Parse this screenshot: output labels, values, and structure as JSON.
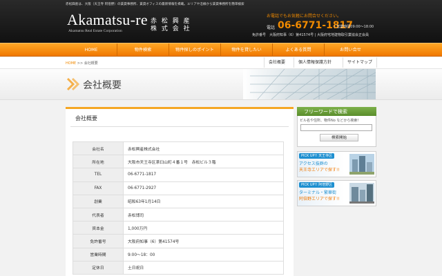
{
  "header": {
    "tagline": "赤松興産は、大阪（天王寺 阿倍野）の賃貸事務所、賃貸オフィスの最新情報を掲載。エリアや沿線から賃貸事務所を簡単検索",
    "logo": "Akamatsu-re",
    "logo_sub": "Akamatsu Real Estate Corporation",
    "company_jp_1": "赤 松 興 産",
    "company_jp_2": "株 式 会 社",
    "phone_cta": "お電話でもお気軽にお問合せください。",
    "phone_label": "電話",
    "phone_number": "06-6771-1817",
    "hours": "| 営業時間09:00～18:00",
    "license": "免許番号　大阪府知事（6）第41574号 | 大阪府宅地建物取引業協会正会員"
  },
  "nav": {
    "items": [
      {
        "label": "HOME"
      },
      {
        "label": "物件検索"
      },
      {
        "label": "物件探しのポイント"
      },
      {
        "label": "物件を貸したい"
      },
      {
        "label": "よくある質問"
      },
      {
        "label": "お問い合せ"
      }
    ]
  },
  "breadcrumb": {
    "home": "HOME",
    "sep": " >> ",
    "current": "会社概要"
  },
  "util_links": [
    {
      "label": "会社概要"
    },
    {
      "label": "個人情報保護方針"
    },
    {
      "label": "サイトマップ"
    }
  ],
  "hero": {
    "title": "会社概要"
  },
  "main": {
    "title": "会社概要",
    "rows": [
      {
        "k": "会社名",
        "v": "赤松興産株式会社"
      },
      {
        "k": "所在地",
        "v": "大阪市天王寺区茶臼山町４番１号　赤松ビル３階"
      },
      {
        "k": "TEL",
        "v": "06-6771-1817"
      },
      {
        "k": "FAX",
        "v": "06-6771-2927"
      },
      {
        "k": "創業",
        "v": "昭和63年1月14日"
      },
      {
        "k": "代表者",
        "v": "赤松博司"
      },
      {
        "k": "資本金",
        "v": "1,000万円"
      },
      {
        "k": "免許番号",
        "v": "大阪府知事（6）第41574号"
      },
      {
        "k": "営業時間",
        "v": "9:00～18：00"
      },
      {
        "k": "定休日",
        "v": "土日祝日"
      }
    ]
  },
  "sidebar": {
    "search_title": "フリーワードで検索",
    "search_note": "ビル名や住所、物件No などから検索！",
    "search_button": "検索開始",
    "banner1": {
      "pick": "PICK UP!! 天王寺区",
      "line1": "アクセス抜群の",
      "line2": "天王寺エリアで探す!!"
    },
    "banner2": {
      "pick": "PICK UP!! 阿倍野区",
      "line1": "ターミナル・繁華街",
      "line2": "阿倍野エリアで探す!!"
    }
  },
  "colors": {
    "accent": "#f08a00",
    "nav": "#f39200",
    "link_blue": "#1d8fd0",
    "side_green": "#6aa13a"
  }
}
